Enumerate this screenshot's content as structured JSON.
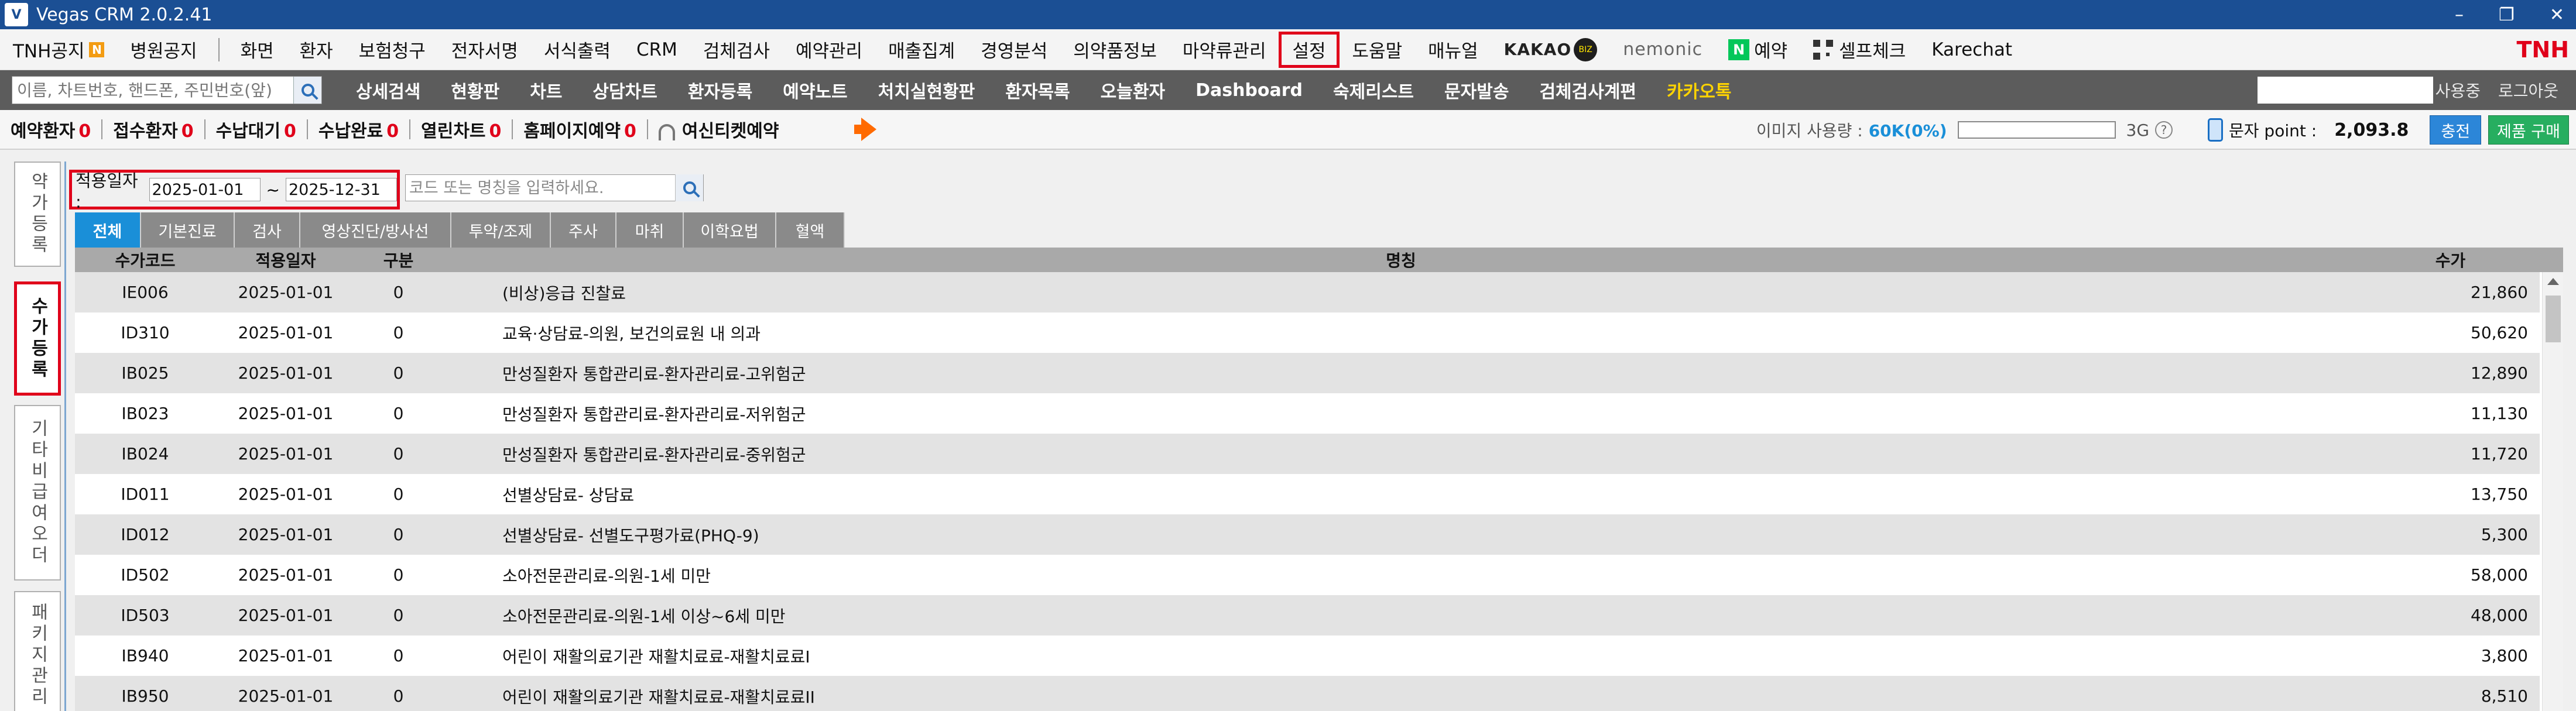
{
  "window": {
    "title": "Vegas CRM 2.0.2.41",
    "logo_text": "V",
    "ctrl_min": "–",
    "ctrl_restore": "❐",
    "ctrl_close": "✕"
  },
  "menu": {
    "notice_label": "TNH공지",
    "notice_badge": "N",
    "hospital_notice": "병원공지",
    "items": [
      "화면",
      "환자",
      "보험청구",
      "전자서명",
      "서식출력",
      "CRM",
      "검체검사",
      "예약관리",
      "매출집계",
      "경영분석",
      "의약품정보",
      "마약류관리",
      "설정",
      "도움말",
      "매뉴얼"
    ],
    "kakao": "KAKAO",
    "kakao_badge": "BIZ",
    "nemonic": "nemonic",
    "naver_n": "N",
    "naver_reserve": "예약",
    "selfcheck": "셀프체크",
    "karechat": "Karechat",
    "brand": "TNH"
  },
  "toolbar": {
    "search_placeholder": "이름, 차트번호, 핸드폰, 주민번호(앞)",
    "links": [
      "상세검색",
      "현황판",
      "차트",
      "상담차트",
      "환자등록",
      "예약노트",
      "처치실현황판",
      "환자목록",
      "오늘환자",
      "Dashboard",
      "숙제리스트",
      "문자발송",
      "검체검사계편"
    ],
    "kakao_talk": "카카오톡",
    "user_label": "사용중",
    "logout": "로그아웃"
  },
  "status": {
    "items": [
      {
        "label": "예약환자",
        "count": "0"
      },
      {
        "label": "접수환자",
        "count": "0"
      },
      {
        "label": "수납대기",
        "count": "0"
      },
      {
        "label": "수납완료",
        "count": "0"
      },
      {
        "label": "열린차트",
        "count": "0"
      },
      {
        "label": "홈페이지예약",
        "count": "0"
      }
    ],
    "ticket_reserve": "여신티켓예약",
    "image_usage_label": "이미지 사용량 :",
    "image_usage_value": "60K(0%)",
    "image_usage_fraction": 0.0,
    "capacity": "3G",
    "help": "?",
    "sms_label": "문자 point :",
    "sms_value": "2,093.8",
    "charge": "충전",
    "buy": "제품 구매",
    "accent_color": "#1a8fd8",
    "alert_color": "#e0001a"
  },
  "left_tabs": [
    "약가등록",
    "수가등록",
    "기타비급여오더",
    "패키지관리"
  ],
  "filter": {
    "date_label": "적용일자 :",
    "date_from": "2025-01-01",
    "tilde": "~",
    "date_to": "2025-12-31",
    "code_placeholder": "코드 또는 명칭을 입력하세요."
  },
  "categories": [
    "전체",
    "기본진료",
    "검사",
    "영상진단/방사선",
    "투약/조제",
    "주사",
    "마취",
    "이학요법",
    "혈액"
  ],
  "table": {
    "headers": {
      "code": "수가코드",
      "date": "적용일자",
      "type": "구분",
      "name": "명칭",
      "price": "수가"
    },
    "rows": [
      {
        "code": "IE006",
        "date": "2025-01-01",
        "type": "0",
        "name": "(비상)응급 진찰료",
        "price": "21,860"
      },
      {
        "code": "ID310",
        "date": "2025-01-01",
        "type": "0",
        "name": "교육·상담료-의원, 보건의료원 내 의과",
        "price": "50,620"
      },
      {
        "code": "IB025",
        "date": "2025-01-01",
        "type": "0",
        "name": "만성질환자 통합관리료-환자관리료-고위험군",
        "price": "12,890"
      },
      {
        "code": "IB023",
        "date": "2025-01-01",
        "type": "0",
        "name": "만성질환자 통합관리료-환자관리료-저위험군",
        "price": "11,130"
      },
      {
        "code": "IB024",
        "date": "2025-01-01",
        "type": "0",
        "name": "만성질환자 통합관리료-환자관리료-중위험군",
        "price": "11,720"
      },
      {
        "code": "ID011",
        "date": "2025-01-01",
        "type": "0",
        "name": "선별상담료- 상담료",
        "price": "13,750"
      },
      {
        "code": "ID012",
        "date": "2025-01-01",
        "type": "0",
        "name": "선별상담료- 선별도구평가료(PHQ-9)",
        "price": "5,300"
      },
      {
        "code": "ID502",
        "date": "2025-01-01",
        "type": "0",
        "name": "소아전문관리료-의원-1세 미만",
        "price": "58,000"
      },
      {
        "code": "ID503",
        "date": "2025-01-01",
        "type": "0",
        "name": "소아전문관리료-의원-1세 이상~6세 미만",
        "price": "48,000"
      },
      {
        "code": "IB940",
        "date": "2025-01-01",
        "type": "0",
        "name": "어린이 재활의료기관 재활치료료-재활치료료I",
        "price": "3,800"
      },
      {
        "code": "IB950",
        "date": "2025-01-01",
        "type": "0",
        "name": "어린이 재활의료기관 재활치료료-재활치료료II",
        "price": "8,510"
      }
    ]
  }
}
